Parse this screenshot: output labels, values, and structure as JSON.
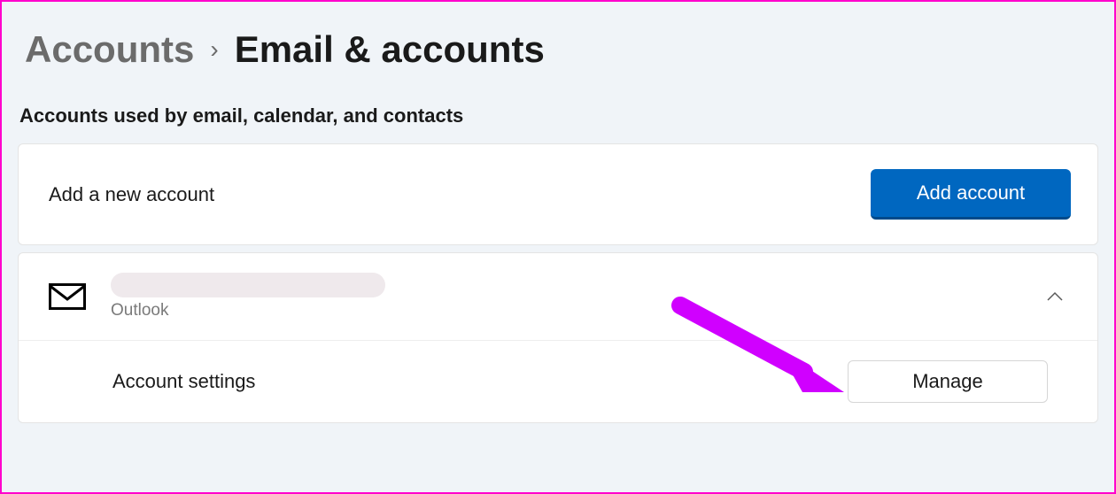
{
  "breadcrumb": {
    "parent": "Accounts",
    "separator": "›",
    "current": "Email & accounts"
  },
  "section": {
    "title": "Accounts used by email, calendar, and contacts"
  },
  "add_row": {
    "label": "Add a new account",
    "button": "Add account"
  },
  "account": {
    "provider": "Outlook",
    "settings_label": "Account settings",
    "manage_button": "Manage"
  }
}
